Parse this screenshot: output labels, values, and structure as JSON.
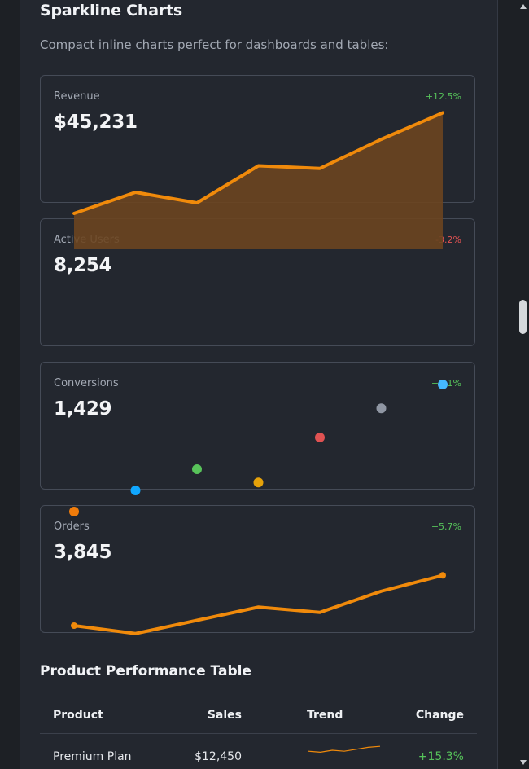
{
  "sparkline_section": {
    "title": "Sparkline Charts",
    "description": "Compact inline charts perfect for dashboards and tables:"
  },
  "cards": [
    {
      "label": "Revenue",
      "value": "$45,231",
      "change": "+12.5%",
      "change_color": "#56c35a"
    },
    {
      "label": "Active Users",
      "value": "8,254",
      "change": "-3.2%",
      "change_color": "#e25252"
    },
    {
      "label": "Conversions",
      "value": "1,429",
      "change": "+8.1%",
      "change_color": "#56c35a"
    },
    {
      "label": "Orders",
      "value": "3,845",
      "change": "+5.7%",
      "change_color": "#56c35a"
    }
  ],
  "chart_data": [
    {
      "type": "area",
      "values": [
        20,
        24,
        22,
        29,
        28.5,
        34,
        39
      ],
      "ylim": [
        0,
        40
      ],
      "color": "#f08a0b",
      "fill_color": "#6b4520"
    },
    {
      "type": "scatter",
      "values": [
        8,
        12,
        16,
        13.5,
        22,
        27.5,
        32
      ],
      "ylim": [
        0,
        40
      ],
      "colors": [
        "#f07c0b",
        "#10a7ff",
        "#58c35a",
        "#e6a20a",
        "#e05252",
        "#8f96a3",
        "#45b9ff"
      ]
    },
    {
      "type": "line",
      "values": [
        22,
        20.5,
        23,
        25.5,
        24.5,
        28.5,
        31.5
      ],
      "ylim": [
        0,
        40
      ],
      "color": "#f08a0b"
    }
  ],
  "table": {
    "title": "Product Performance Table",
    "headers": {
      "product": "Product",
      "sales": "Sales",
      "trend": "Trend",
      "change": "Change"
    },
    "rows": [
      {
        "product": "Premium Plan",
        "sales": "$12,450",
        "trend": [
          2,
          1.5,
          2.5,
          2,
          3,
          4,
          4.5
        ],
        "change": "+15.3%"
      }
    ]
  },
  "colors": {
    "background": "#1d2025",
    "panel": "#23272f",
    "positive": "#56c35a",
    "negative": "#e25252"
  }
}
